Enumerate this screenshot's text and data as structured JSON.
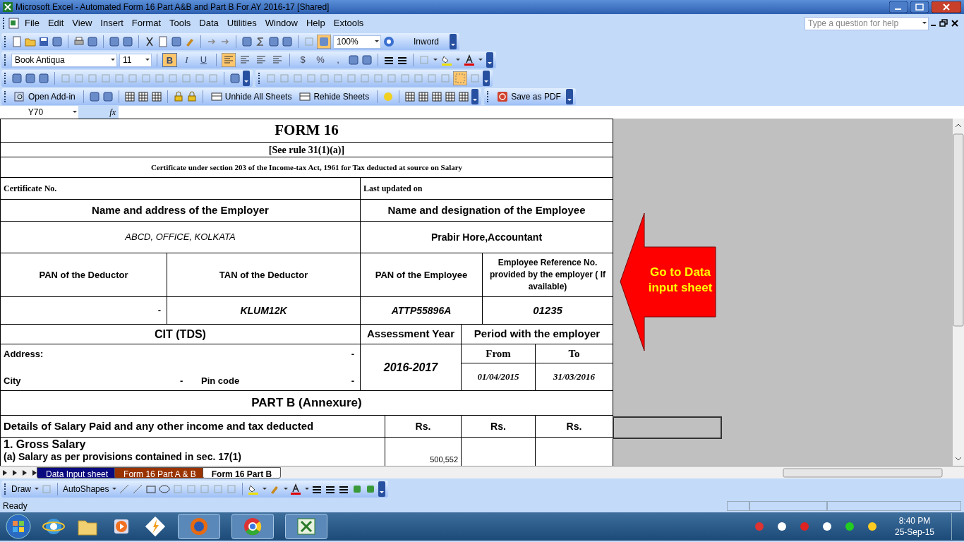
{
  "window": {
    "title": "Microsoft Excel - Automated Form 16 Part A&B and Part B For AY 2016-17  [Shared]"
  },
  "menu": [
    "File",
    "Edit",
    "View",
    "Insert",
    "Format",
    "Tools",
    "Data",
    "Utilities",
    "Window",
    "Help",
    "Extools"
  ],
  "help_box": {
    "placeholder": "Type a question for help"
  },
  "standard_toolbar": {
    "zoom": "100%",
    "inword": "Inword"
  },
  "formatting_toolbar": {
    "font": "Book Antiqua",
    "size": "11",
    "style_buttons": [
      {
        "label": "B",
        "selected": true
      },
      {
        "label": "I",
        "selected": false
      },
      {
        "label": "U",
        "selected": false
      }
    ],
    "align_buttons": [
      {
        "selected": true
      },
      {
        "selected": false
      },
      {
        "selected": false
      },
      {
        "selected": false
      }
    ],
    "number_buttons": [
      "$",
      "%",
      ","
    ]
  },
  "addin_toolbar": {
    "open": "Open Add-in",
    "unhide": "Unhide All Sheets",
    "rehide": "Rehide Sheets",
    "save_pdf": "Save as PDF"
  },
  "formula_bar": {
    "name_box": "Y70",
    "fx": "fx"
  },
  "form": {
    "title": "FORM 16",
    "rule": "[See rule 31(1)(a)]",
    "caption": "Certificate under section 203 of the Income-tax Act, 1961 for Tax deducted at source on Salary",
    "certificate_no": "Certificate No.",
    "last_updated": "Last updated on",
    "employer_heading": "Name and address of the Employer",
    "employee_heading": "Name and designation of the Employee",
    "employer": "ABCD, OFFICE, KOLKATA",
    "employee": "Prabir Hore,Accountant",
    "pan_deductor": "PAN of the Deductor",
    "tan_deductor": "TAN of the Deductor",
    "pan_employee": "PAN of the Employee",
    "employee_ref": "Employee Reference No. provided by the employer ( If available)",
    "pan_deductor_value": "-",
    "tan_deductor_value": "KLUM12K",
    "pan_employee_value": "ATTP55896A",
    "employee_ref_value": "01235",
    "cit": "CIT (TDS)",
    "assessment_year": "Assessment Year",
    "period": "Period with the employer",
    "address_label": "Address:",
    "address_value": "-",
    "city_label": "City",
    "city_value": "-",
    "pin_label": "Pin code",
    "pin_value": "-",
    "assessment_year_value": "2016-2017",
    "from": "From",
    "to": "To",
    "from_value": "01/04/2015",
    "to_value": "31/03/2016",
    "part_b": "PART B (Annexure)",
    "details": "Details of Salary Paid and any other income and tax deducted",
    "rs": [
      "Rs.",
      "Rs.",
      "Rs."
    ],
    "gross_salary": "1.  Gross Salary",
    "salary_17_1": "(a) Salary as per provisions contained in sec. 17(1)",
    "salary_17_1_value": "500,552"
  },
  "callout": {
    "text": "Go to Data input sheet"
  },
  "sheet_tabs": [
    {
      "label": "Data Input sheet",
      "selected": false,
      "color": "#0a0a80"
    },
    {
      "label": "Form 16 Part A & B",
      "selected": false,
      "color": "#993300"
    },
    {
      "label": "Form 16 Part B",
      "selected": true
    }
  ],
  "draw_toolbar": {
    "draw": "Draw",
    "autoshapes": "AutoShapes"
  },
  "status_bar": {
    "text": "Ready"
  },
  "taskbar": {
    "time": "8:40 PM",
    "date": "25-Sep-15"
  }
}
